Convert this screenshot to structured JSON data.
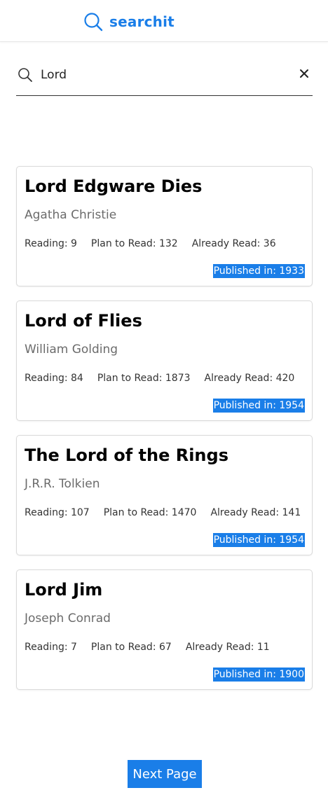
{
  "header": {
    "brand": "searchit",
    "logo_icon": "search-icon",
    "accent_color": "#1a7ee8"
  },
  "search": {
    "value": "Lord",
    "icon": "search-icon",
    "clear_icon": "close-icon"
  },
  "results": [
    {
      "title": "Lord Edgware Dies",
      "author": "Agatha Christie",
      "reading": "Reading: 9",
      "plan_to_read": "Plan to Read: 132",
      "already_read": "Already Read: 36",
      "published": "Published in: 1933"
    },
    {
      "title": "Lord of Flies",
      "author": "William Golding",
      "reading": "Reading: 84",
      "plan_to_read": "Plan to Read: 1873",
      "already_read": "Already Read: 420",
      "published": "Published in: 1954"
    },
    {
      "title": "The Lord of the Rings",
      "author": "J.R.R. Tolkien",
      "reading": "Reading: 107",
      "plan_to_read": "Plan to Read: 1470",
      "already_read": "Already Read: 141",
      "published": "Published in: 1954"
    },
    {
      "title": "Lord Jim",
      "author": "Joseph Conrad",
      "reading": "Reading: 7",
      "plan_to_read": "Plan to Read: 67",
      "already_read": "Already Read: 11",
      "published": "Published in: 1900"
    }
  ],
  "pagination": {
    "next_label": "Next Page"
  }
}
